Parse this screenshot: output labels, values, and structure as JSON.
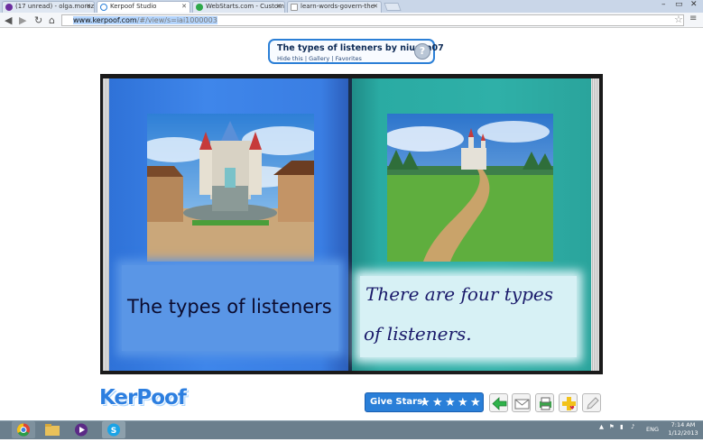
{
  "browser": {
    "tabs": [
      {
        "label": "(17 unread) - olga.moroz",
        "icon": "yahoo-icon",
        "active": false
      },
      {
        "label": "Kerpoof Studio",
        "icon": "kerpoof-icon",
        "active": true
      },
      {
        "label": "WebStarts.com - Custom",
        "icon": "webstarts-icon",
        "active": false
      },
      {
        "label": "learn-words-govern-the-",
        "icon": "page-icon",
        "active": false
      }
    ],
    "url_host": "www.kerpoof.com",
    "url_path": "/#/view/s=iai1000003"
  },
  "story": {
    "title": "The types of listeners by niusea07",
    "links": [
      "Hide this",
      "Gallery",
      "Favorites"
    ],
    "help_label": "?"
  },
  "book": {
    "left_text": "The types of listeners",
    "right_text_line1": "There are four types",
    "right_text_line2": "of listeners."
  },
  "bottom": {
    "logo": "KerPoof",
    "give_stars": "Give Stars!",
    "star_count": 5,
    "stars": "★★★★★"
  },
  "taskbar": {
    "lang": "ENG",
    "time": "7:14 AM",
    "date": "1/12/2013"
  }
}
